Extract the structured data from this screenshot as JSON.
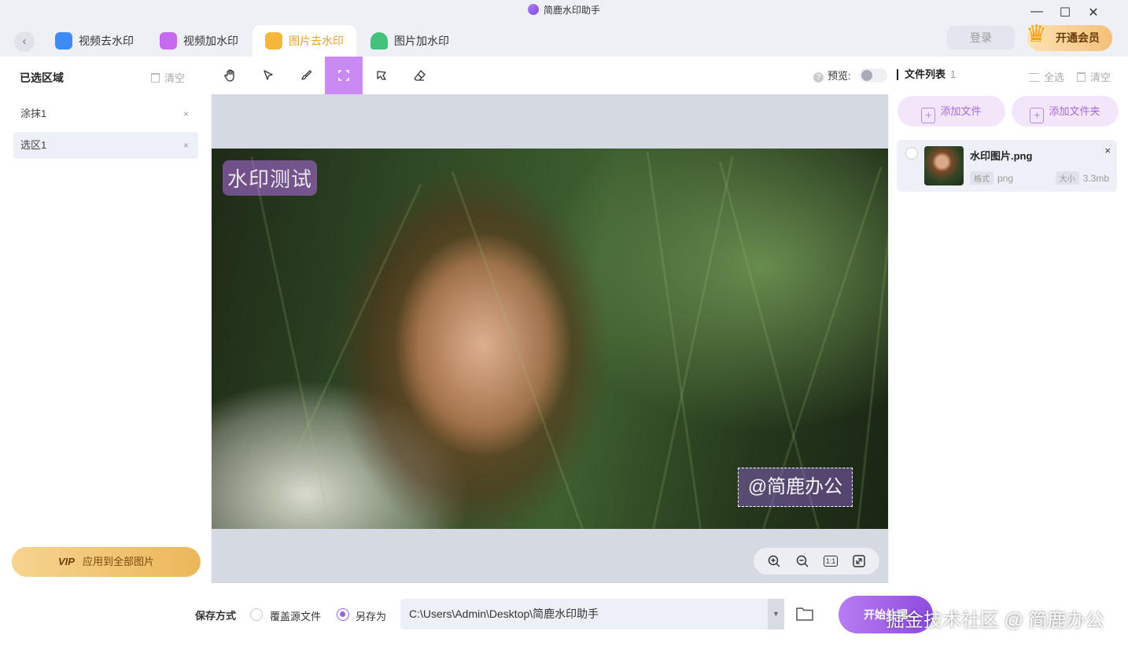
{
  "app": {
    "title": "简鹿水印助手"
  },
  "window_controls": {
    "minimize": "—",
    "maximize": "☐",
    "close": "✕"
  },
  "tabs": [
    {
      "label": "视频去水印",
      "color": "#3d8cf5"
    },
    {
      "label": "视频加水印",
      "color": "#c86af0"
    },
    {
      "label": "图片去水印",
      "color": "#f5b73a",
      "active": true
    },
    {
      "label": "图片加水印",
      "color": "#42c27a"
    }
  ],
  "header": {
    "login_label": "登录",
    "vip_label": "开通会员",
    "vip_badge": "VIP"
  },
  "left_panel": {
    "title": "已选区域",
    "clear_label": "清空",
    "regions": [
      {
        "label": "涂抹1",
        "close": "×"
      },
      {
        "label": "选区1",
        "close": "×",
        "selected": true
      }
    ],
    "apply_vip": "VIP",
    "apply_label": "应用到全部图片"
  },
  "toolbar": {
    "tools": [
      "hand-icon",
      "pointer-icon",
      "brush-icon",
      "rect-select-icon",
      "lasso-icon",
      "eraser-icon"
    ],
    "active_tool": "rect-select-icon",
    "preview_label": "预览:",
    "preview_help": "?",
    "preview_enabled": false
  },
  "canvas": {
    "watermark_1": "水印测试",
    "watermark_2": "@简鹿办公",
    "zoom_tools": [
      "zoom-in-icon",
      "zoom-out-icon",
      "actual-size-icon",
      "fit-screen-icon"
    ],
    "actual_size_label": "1:1"
  },
  "file_list": {
    "title": "文件列表",
    "count": "1",
    "select_all_label": "全选",
    "clear_label": "清空",
    "add_file_label": "添加文件",
    "add_folder_label": "添加文件夹",
    "files": [
      {
        "name": "水印图片.png",
        "format_tag": "格式",
        "format": "png",
        "size_tag": "大小",
        "size": "3.3mb",
        "close": "×"
      }
    ]
  },
  "bottom": {
    "save_mode_label": "保存方式",
    "overwrite_label": "覆盖源文件",
    "save_as_label": "另存为",
    "selected_mode": "save_as",
    "path": "C:\\Users\\Admin\\Desktop\\简鹿水印助手",
    "start_label": "开始处理",
    "footer_watermark": "掘金技术社区 @ 简鹿办公"
  },
  "colors": {
    "accent": "#9a5ee8",
    "active_tab_text": "#e8a030",
    "tool_active_bg": "#c98bf3"
  }
}
